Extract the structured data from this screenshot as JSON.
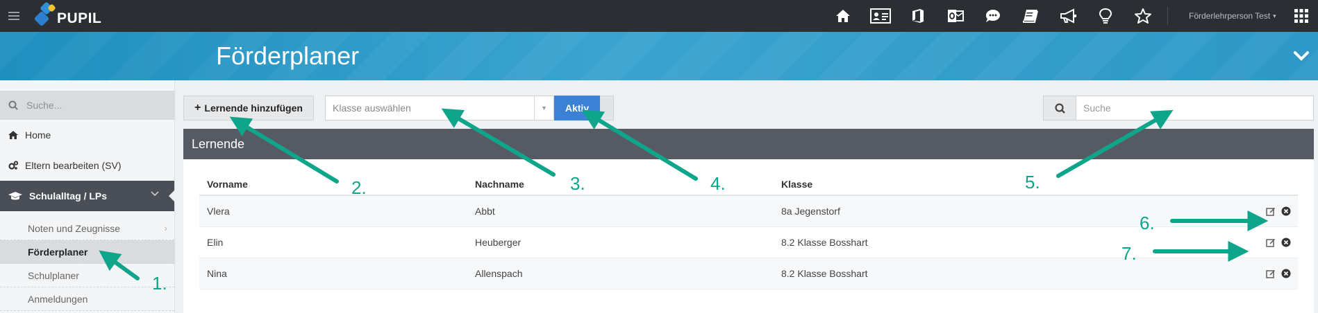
{
  "app": {
    "logo_text": "PUPIL"
  },
  "topbar": {
    "icons": [
      "home-icon",
      "id-card-icon",
      "office-icon",
      "outlook-icon",
      "chat-icon",
      "book-icon",
      "megaphone-icon",
      "lightbulb-icon",
      "star-icon"
    ],
    "user_name": "Förderlehrperson Test",
    "user_caret": "▾"
  },
  "banner": {
    "title": "Förderplaner"
  },
  "sidebar": {
    "search_placeholder": "Suche...",
    "items": [
      {
        "label": "Home",
        "icon": "home-icon"
      },
      {
        "label": "Eltern bearbeiten (SV)",
        "icon": "cogs-icon"
      },
      {
        "label": "Schulalltag / LPs",
        "icon": "graduation-cap-icon"
      }
    ],
    "subitems": [
      {
        "label": "Noten und Zeugnisse",
        "chevron": "›"
      },
      {
        "label": "Förderplaner"
      },
      {
        "label": "Schulplaner"
      },
      {
        "label": "Anmeldungen"
      }
    ]
  },
  "toolbar": {
    "add_plus": "+",
    "add_label": "Lernende hinzufügen",
    "class_placeholder": "Klasse auswählen",
    "class_arrow": "▼",
    "aktiv_label": "Aktiv",
    "search_placeholder": "Suche"
  },
  "panel": {
    "title": "Lernende",
    "columns": [
      "Vorname",
      "Nachname",
      "Klasse"
    ],
    "rows": [
      {
        "vorname": "Vlera",
        "nachname": "Abbt",
        "klasse": "8a Jegenstorf"
      },
      {
        "vorname": "Elin",
        "nachname": "Heuberger",
        "klasse": "8.2 Klasse Bosshart"
      },
      {
        "vorname": "Nina",
        "nachname": "Allenspach",
        "klasse": "8.2 Klasse Bosshart"
      }
    ]
  },
  "annotations": {
    "color": "#0ea58a",
    "labels": [
      "1.",
      "2.",
      "3.",
      "4.",
      "5.",
      "6.",
      "7."
    ]
  }
}
